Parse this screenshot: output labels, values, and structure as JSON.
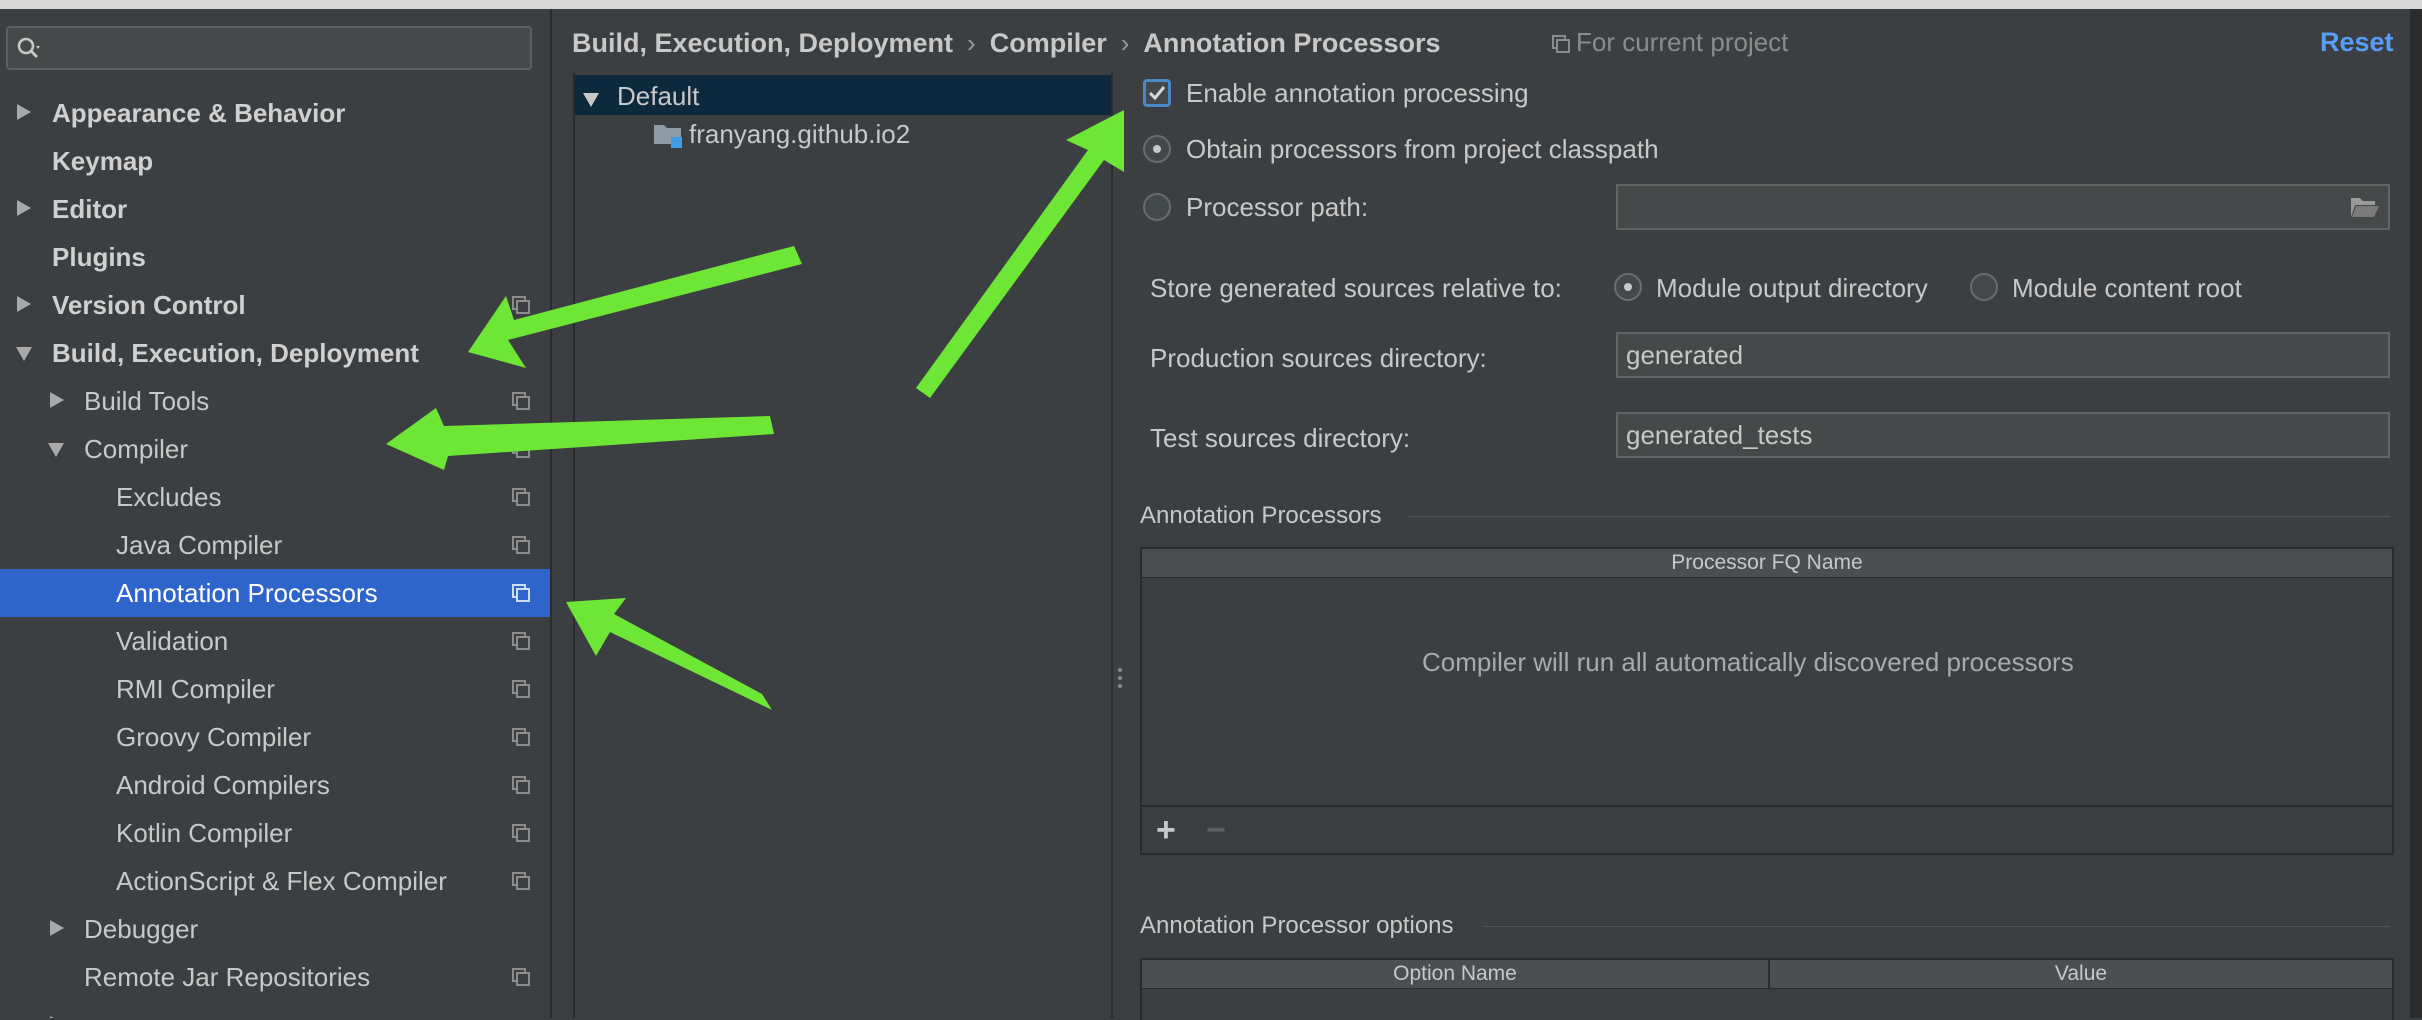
{
  "sidebar": {
    "search": {
      "placeholder": "",
      "value": ""
    },
    "items": [
      {
        "label": "Appearance & Behavior"
      },
      {
        "label": "Keymap"
      },
      {
        "label": "Editor"
      },
      {
        "label": "Plugins"
      },
      {
        "label": "Version Control"
      },
      {
        "label": "Build, Execution, Deployment"
      },
      {
        "label": "Build Tools"
      },
      {
        "label": "Compiler"
      },
      {
        "label": "Excludes"
      },
      {
        "label": "Java Compiler"
      },
      {
        "label": "Annotation Processors"
      },
      {
        "label": "Validation"
      },
      {
        "label": "RMI Compiler"
      },
      {
        "label": "Groovy Compiler"
      },
      {
        "label": "Android Compilers"
      },
      {
        "label": "Kotlin Compiler"
      },
      {
        "label": "ActionScript & Flex Compiler"
      },
      {
        "label": "Debugger"
      },
      {
        "label": "Remote Jar Repositories"
      }
    ]
  },
  "header": {
    "breadcrumbs": [
      "Build, Execution, Deployment",
      "Compiler",
      "Annotation Processors"
    ],
    "scope_label": "For current project",
    "reset_label": "Reset"
  },
  "profiles": {
    "default_label": "Default",
    "module_label": "franyang.github.io2"
  },
  "options": {
    "enable_label": "Enable annotation processing",
    "enable_checked": true,
    "obtain_label": "Obtain processors from project classpath",
    "processor_path_label": "Processor path:",
    "processor_path_value": "",
    "store_label": "Store generated sources relative to:",
    "module_output_label": "Module output directory",
    "module_content_label": "Module content root",
    "production_label": "Production sources directory:",
    "production_value": "generated",
    "test_label": "Test sources directory:",
    "test_value": "generated_tests"
  },
  "processors_section": {
    "title": "Annotation Processors",
    "column": "Processor FQ Name",
    "empty_text": "Compiler will run all automatically discovered processors",
    "add_label": "+",
    "remove_label": "−"
  },
  "options_section": {
    "title": "Annotation Processor options",
    "columns": [
      "Option Name",
      "Value"
    ]
  },
  "colors": {
    "background": "#3c3f41",
    "selection": "#2f65ca",
    "accent_link": "#589df6",
    "annotation_arrow": "#6ee635"
  }
}
